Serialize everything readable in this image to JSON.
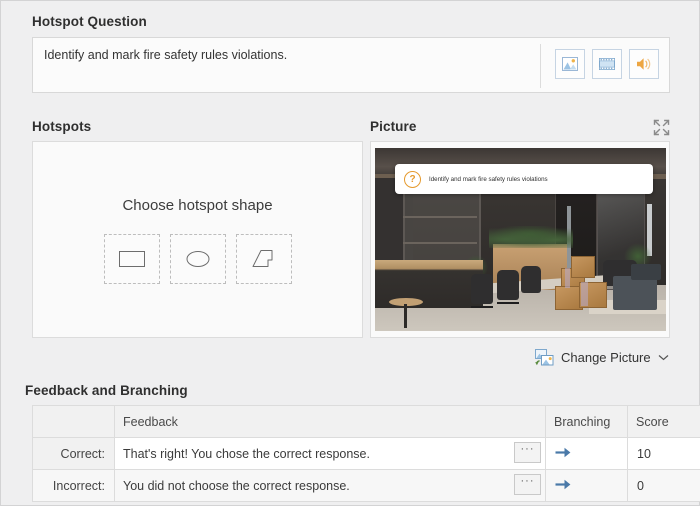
{
  "question": {
    "section_label": "Hotspot Question",
    "text": "Identify and mark fire safety rules violations.",
    "media_buttons": [
      {
        "name": "insert-image-button",
        "icon": "image-icon",
        "title": "Insert picture"
      },
      {
        "name": "insert-video-button",
        "icon": "video-icon",
        "title": "Insert video"
      },
      {
        "name": "insert-audio-button",
        "icon": "audio-icon",
        "title": "Insert audio"
      }
    ]
  },
  "hotspots": {
    "section_label": "Hotspots",
    "prompt": "Choose hotspot shape",
    "shapes": [
      {
        "name": "shape-rectangle",
        "icon": "rectangle-icon",
        "label": "Rectangle"
      },
      {
        "name": "shape-ellipse",
        "icon": "ellipse-icon",
        "label": "Ellipse"
      },
      {
        "name": "shape-freeform",
        "icon": "freeform-icon",
        "label": "Freeform"
      }
    ]
  },
  "picture": {
    "section_label": "Picture",
    "expand_icon": "expand-icon",
    "overlay": {
      "badge": "?",
      "text": "Identify and mark fire safety rules violations",
      "badge_color": "#e59a2e"
    },
    "change_button": {
      "label": "Change Picture",
      "icon": "change-picture-icon",
      "caret": "⌄"
    }
  },
  "feedback": {
    "section_label": "Feedback and Branching",
    "columns": [
      "",
      "Feedback",
      "Branching",
      "Score"
    ],
    "rows": [
      {
        "label": "Correct:",
        "feedback": "That's right! You chose the correct response.",
        "more_button": "···",
        "branching_icon": "branch-arrow-icon",
        "score": "10"
      },
      {
        "label": "Incorrect:",
        "feedback": "You did not choose the correct response.",
        "more_button": "···",
        "branching_icon": "branch-arrow-icon",
        "score": "0"
      }
    ]
  },
  "colors": {
    "background": "#efeff0",
    "panel": "#fafafa",
    "border": "#dcdcdc",
    "accent_blue": "#4a79a8",
    "accent_orange": "#e59a2e"
  }
}
